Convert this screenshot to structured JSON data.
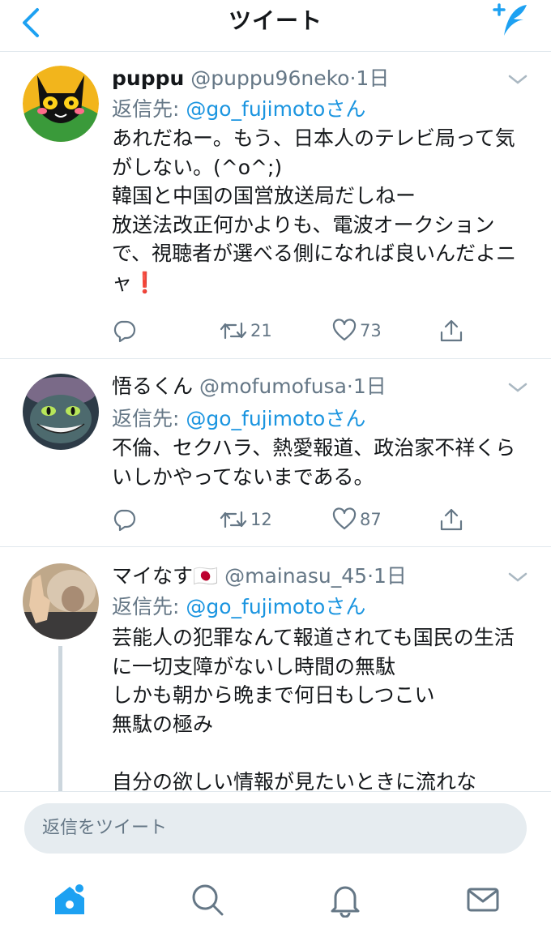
{
  "header": {
    "title": "ツイート"
  },
  "icons": {
    "back": "chevron-left-icon",
    "compose": "compose-feather-icon",
    "caret": "chevron-down-icon",
    "reply": "reply-icon",
    "retweet": "retweet-icon",
    "like": "heart-icon",
    "share": "share-icon",
    "home": "home-icon",
    "search": "search-icon",
    "notifications": "bell-icon",
    "messages": "mail-icon"
  },
  "colors": {
    "accent": "#1da1f2",
    "mention": "#1b95e0",
    "muted": "#657786",
    "text": "#14171a",
    "divider": "#e1e8ed",
    "alert": "#e0245e"
  },
  "tweets": [
    {
      "name": "puppu",
      "handle": "@puppu96neko",
      "sep": "·",
      "time": "1日",
      "reply_prefix": "返信先: ",
      "reply_to": "@go_fujimotoさん",
      "text": "あれだねー。もう、日本人のテレビ局って気がしない。(^o^;)\n韓国と中国の国営放送局だしねー\n放送法改正何かよりも、電波オークションで、視聴者が選べる側になれば良いんだよニャ",
      "emoji": "❗",
      "retweets": "21",
      "likes": "73"
    },
    {
      "name": "悟るくん",
      "handle": "@mofumofusa",
      "sep": "·",
      "time": "1日",
      "reply_prefix": "返信先: ",
      "reply_to": "@go_fujimotoさん",
      "text": "不倫、セクハラ、熱愛報道、政治家不祥くらいしかやってないまである。",
      "retweets": "12",
      "likes": "87"
    },
    {
      "name": "マイなす",
      "flag": "🇯🇵",
      "handle": "@mainasu_45",
      "sep": "·",
      "time": "1日",
      "reply_prefix": "返信先: ",
      "reply_to": "@go_fujimotoさん",
      "text": "芸能人の犯罪なんて報道されても国民の生活に一切支障がないし時間の無駄\nしかも朝から晩まで何日もしつこい\n無駄の極み\n\n自分の欲しい情報が見たいときに流れな"
    }
  ],
  "reply_box": {
    "placeholder": "返信をツイート"
  }
}
